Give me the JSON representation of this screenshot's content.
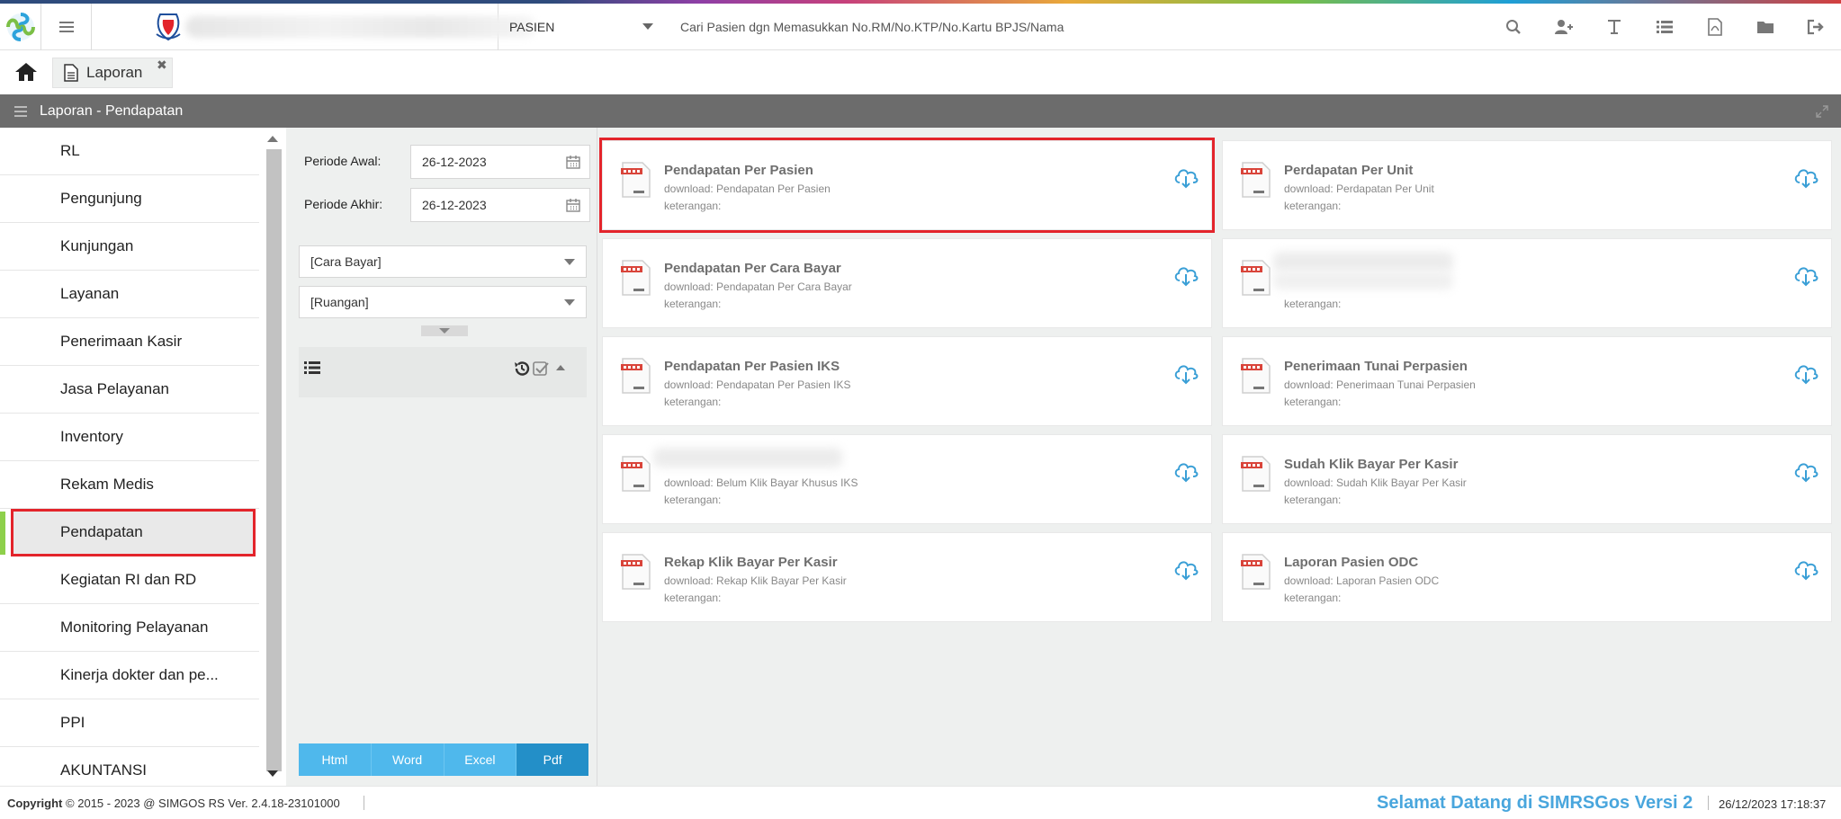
{
  "header": {
    "patient_scope": "PASIEN",
    "search_placeholder": "Cari Pasien dgn Memasukkan No.RM/No.KTP/No.Kartu BPJS/Nama",
    "toolbar_icons": [
      "search-icon",
      "add-user-icon",
      "text-icon",
      "list-icon",
      "pdf-icon",
      "folder-icon",
      "logout-icon"
    ]
  },
  "tabs": [
    {
      "label": "Laporan",
      "active": true
    }
  ],
  "panel": {
    "title": "Laporan - Pendapatan"
  },
  "nav": {
    "items": [
      {
        "label": "RL"
      },
      {
        "label": "Pengunjung"
      },
      {
        "label": "Kunjungan"
      },
      {
        "label": "Layanan"
      },
      {
        "label": "Penerimaan Kasir"
      },
      {
        "label": "Jasa Pelayanan"
      },
      {
        "label": "Inventory"
      },
      {
        "label": "Rekam Medis"
      },
      {
        "label": "Pendapatan",
        "active": true
      },
      {
        "label": "Kegiatan RI dan RD"
      },
      {
        "label": "Monitoring Pelayanan"
      },
      {
        "label": "Kinerja dokter dan pe..."
      },
      {
        "label": "PPI"
      },
      {
        "label": "AKUNTANSI"
      }
    ]
  },
  "filter": {
    "periode_awal_label": "Periode Awal:",
    "periode_awal": "26-12-2023",
    "periode_akhir_label": "Periode Akhir:",
    "periode_akhir": "26-12-2023",
    "cara_bayar": "[Cara Bayar]",
    "ruangan": "[Ruangan]",
    "formats": [
      "Html",
      "Word",
      "Excel",
      "Pdf"
    ],
    "selected_format": "Pdf"
  },
  "reports": [
    {
      "title": "Pendapatan Per Pasien",
      "download": "download: Pendapatan Per Pasien",
      "keterangan": "keterangan:",
      "selected": true
    },
    {
      "title": "Perdapatan Per Unit",
      "download": "download: Perdapatan Per Unit",
      "keterangan": "keterangan:"
    },
    {
      "title": "Pendapatan Per Cara Bayar",
      "download": "download: Pendapatan Per Cara Bayar",
      "keterangan": "keterangan:"
    },
    {
      "title": "",
      "download": "",
      "keterangan": "keterangan:",
      "obscured": true
    },
    {
      "title": "Pendapatan Per Pasien IKS",
      "download": "download: Pendapatan Per Pasien IKS",
      "keterangan": "keterangan:"
    },
    {
      "title": "Penerimaan Tunai Perpasien",
      "download": "download: Penerimaan Tunai Perpasien",
      "keterangan": "keterangan:"
    },
    {
      "title": "",
      "download": "download: Belum Klik Bayar Khusus IKS",
      "keterangan": "keterangan:",
      "obscured": true
    },
    {
      "title": "Sudah Klik Bayar Per Kasir",
      "download": "download: Sudah Klik Bayar Per Kasir",
      "keterangan": "keterangan:"
    },
    {
      "title": "Rekap Klik Bayar Per Kasir",
      "download": "download: Rekap Klik Bayar Per Kasir",
      "keterangan": "keterangan:"
    },
    {
      "title": "Laporan Pasien ODC",
      "download": "download: Laporan Pasien ODC",
      "keterangan": "keterangan:"
    }
  ],
  "footer": {
    "copyright_prefix": "Copyright",
    "copyright_rest": "2015 - 2023 @ SIMGOS RS Ver. 2.4.18-23101000",
    "welcome": "Selamat Datang di SIMRSGos Versi 2 K",
    "datetime": "26/12/2023 17:18:37"
  },
  "colors": {
    "selection": "#e3242b",
    "accent": "#4fb8ec",
    "accent_active": "#238fc8",
    "panel_header": "#6c6c6c",
    "welcome_text": "#49a6dd"
  }
}
